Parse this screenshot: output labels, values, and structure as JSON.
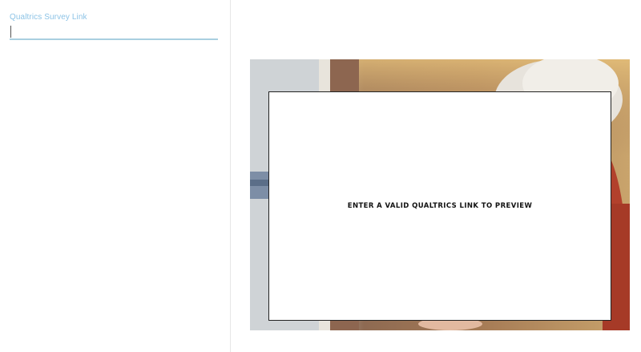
{
  "survey_field": {
    "label": "Qualtrics Survey Link",
    "value": "",
    "placeholder": ""
  },
  "preview": {
    "message": "ENTER A VALID QUALTRICS LINK TO PREVIEW",
    "background_image": "portrait-photo-woman-gray-hair"
  },
  "colors": {
    "label": "#8cc3e6",
    "input_underline": "#a9cfe0",
    "card_border": "#222222"
  }
}
